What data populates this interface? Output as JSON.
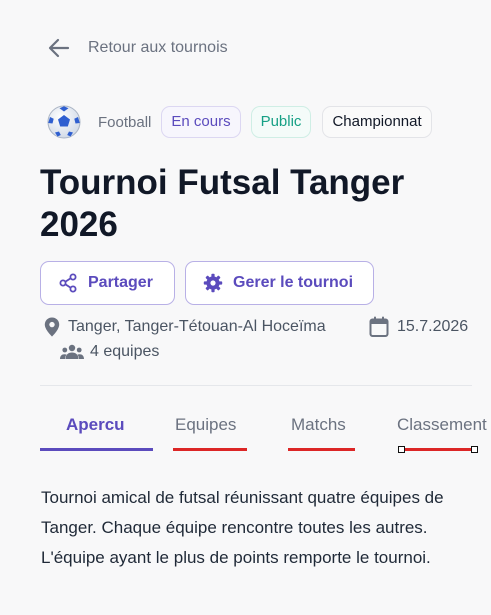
{
  "back": {
    "label": "Retour aux tournois"
  },
  "tournament": {
    "sport": "Football",
    "status": "En cours",
    "visibility": "Public",
    "type": "Championnat",
    "title": "Tournoi Futsal Tanger 2026",
    "location": "Tanger, Tanger-Tétouan-Al Hoceïma",
    "date": "15.7.2026",
    "teams_count": "4 equipes",
    "description": "Tournoi amical de futsal réunissant quatre équipes de Tanger. Chaque équipe rencontre toutes les autres. L'équipe ayant le plus de points remporte le tournoi."
  },
  "actions": {
    "share_label": "Partager",
    "manage_label": "Gerer le tournoi"
  },
  "tabs": [
    {
      "label": "Apercu",
      "active": true
    },
    {
      "label": "Equipes",
      "active": false
    },
    {
      "label": "Matchs",
      "active": false
    },
    {
      "label": "Classement",
      "active": false
    }
  ],
  "colors": {
    "accent": "#5b4bbd",
    "success": "#16a085",
    "annotation_red": "#dc2626"
  },
  "icons": [
    "arrow-left-icon",
    "soccer-ball-icon",
    "share-icon",
    "gear-icon",
    "map-pin-icon",
    "calendar-icon",
    "users-icon"
  ]
}
